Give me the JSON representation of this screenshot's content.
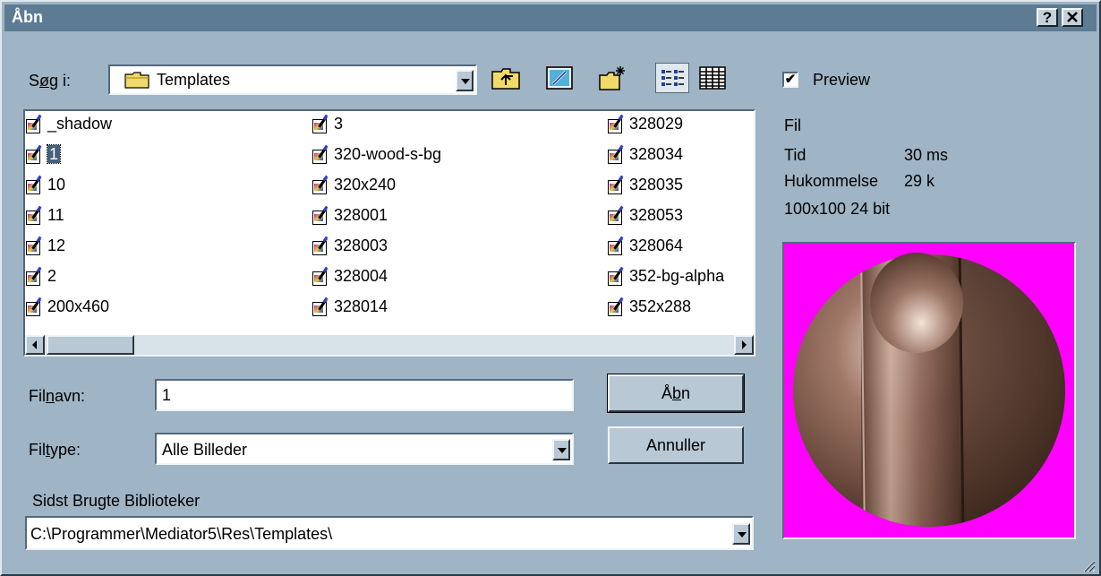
{
  "window": {
    "title": "Åbn",
    "help_button": "?",
    "close_button": "✕"
  },
  "look_in": {
    "label_prefix": "S",
    "label_underlined": "ø",
    "label_rest": "g i:",
    "value": "Templates"
  },
  "toolbar": {
    "up_icon": "up-one-level-icon",
    "desktop_icon": "desktop-icon",
    "new_folder_icon": "new-folder-icon",
    "list_view_icon": "list-view-icon",
    "details_view_icon": "details-view-icon"
  },
  "files": [
    "_shadow",
    "1",
    "10",
    "11",
    "12",
    "2",
    "200x460",
    "3",
    "320-wood-s-bg",
    "320x240",
    "328001",
    "328003",
    "328004",
    "328014",
    "328029",
    "328034",
    "328035",
    "328053",
    "328064",
    "352-bg-alpha",
    "352x288"
  ],
  "selected_file": "1",
  "filename": {
    "label_pre": "Fil",
    "label_u": "n",
    "label_post": "avn:",
    "value": "1"
  },
  "filetype": {
    "label_pre": "Fil",
    "label_u": "t",
    "label_post": "ype:",
    "value": "Alle Billeder"
  },
  "recent": {
    "label": "Sidst Brugte Biblioteker",
    "value": "C:\\Programmer\\Mediator5\\Res\\Templates\\"
  },
  "buttons": {
    "open_pre": "Å",
    "open_u": "b",
    "open_post": "n",
    "cancel": "Annuller"
  },
  "preview": {
    "checkbox_label": "Preview",
    "checked": true,
    "info": {
      "fil_label": "Fil",
      "tid_label": "Tid",
      "tid_value": "30 ms",
      "mem_label": "Hukommelse",
      "mem_value": "29 k",
      "dims": "100x100 24 bit"
    }
  },
  "colors": {
    "background": "#9fb4c4",
    "titlebar": "#5d7c93",
    "preview_bg": "#ff00ff",
    "selection": "#44607a"
  }
}
